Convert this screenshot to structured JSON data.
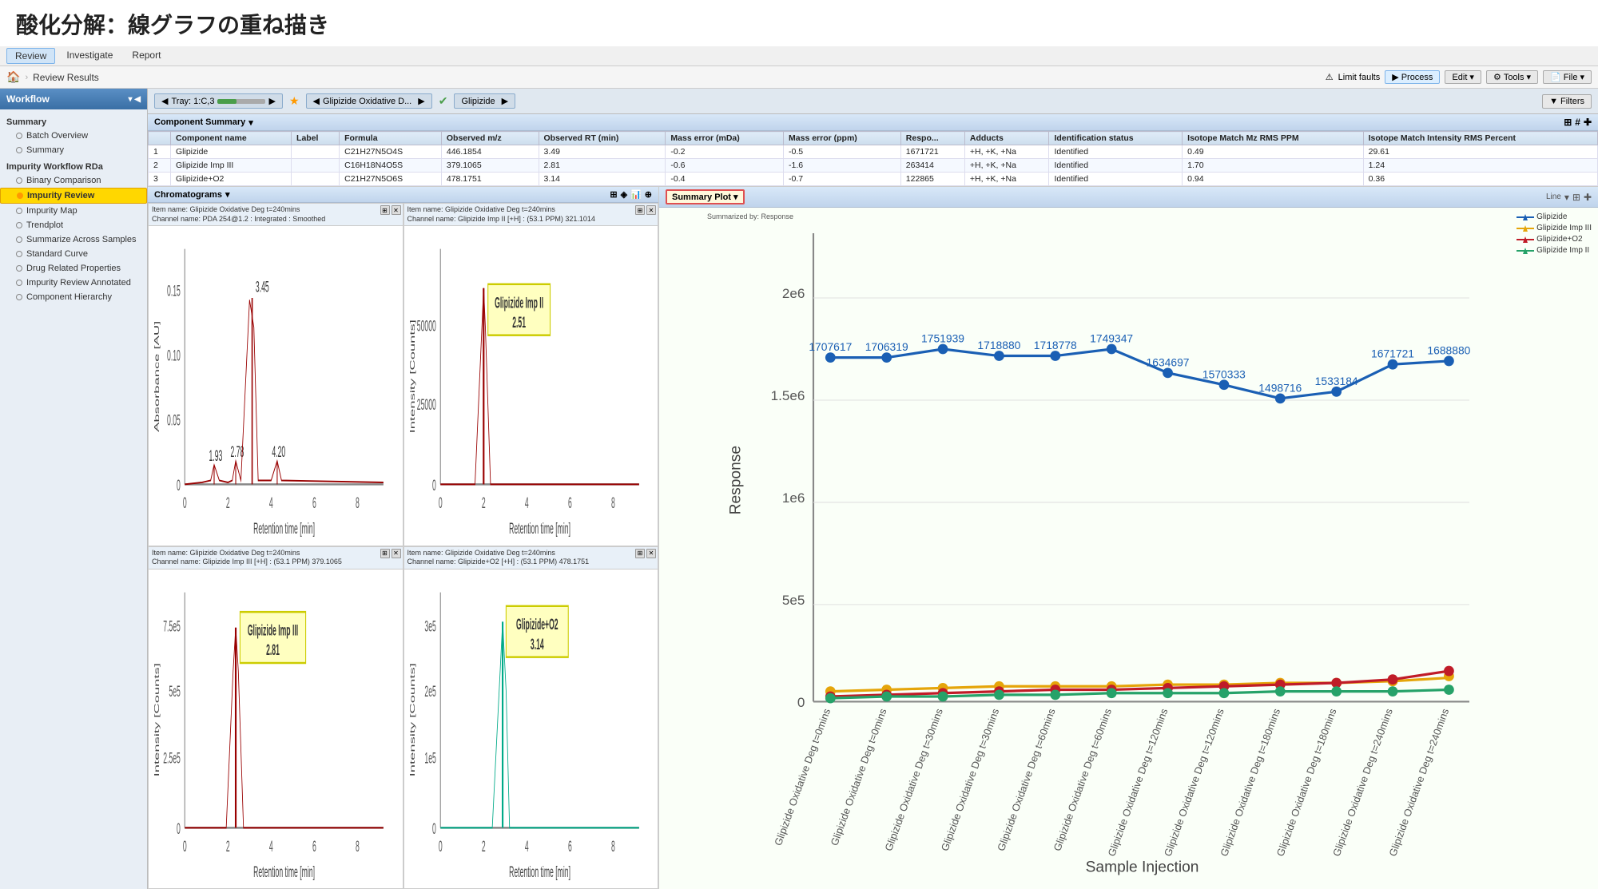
{
  "pageTitle": "酸化分解：線グラフの重ね描き",
  "menuItems": [
    {
      "label": "Review",
      "active": true
    },
    {
      "label": "Investigate",
      "active": false
    },
    {
      "label": "Report",
      "active": false
    }
  ],
  "toolbar": {
    "homeIcon": "🏠",
    "breadcrumb": "Review Results",
    "limitFaults": "Limit faults",
    "process": "Process",
    "edit": "Edit",
    "tools": "Tools",
    "file": "File",
    "filters": "Filters"
  },
  "tray": {
    "label": "Tray: 1:C,3",
    "sampleName": "Glipizide Oxidative D...",
    "compoundName": "Glipizide"
  },
  "sidebar": {
    "header": "Workflow",
    "sections": [
      {
        "label": "Summary",
        "items": [
          {
            "label": "Batch Overview",
            "active": false
          },
          {
            "label": "Summary",
            "active": false
          }
        ]
      },
      {
        "label": "Impurity Workflow RDa",
        "items": [
          {
            "label": "Binary Comparison",
            "active": false
          },
          {
            "label": "Impurity Review",
            "active": true
          },
          {
            "label": "Impurity Map",
            "active": false
          },
          {
            "label": "Trendplot",
            "active": false
          },
          {
            "label": "Summarize Across Samples",
            "active": false
          },
          {
            "label": "Standard Curve",
            "active": false
          },
          {
            "label": "Drug Related Properties",
            "active": false
          },
          {
            "label": "Impurity Review Annotated",
            "active": false
          },
          {
            "label": "Component Hierarchy",
            "active": false
          }
        ]
      }
    ]
  },
  "componentSummary": {
    "title": "Component Summary",
    "columns": [
      "",
      "Component name",
      "Label",
      "Formula",
      "Observed m/z",
      "Observed RT (min)",
      "Mass error (mDa)",
      "Mass error (ppm)",
      "Respo...",
      "Adducts",
      "Identification status",
      "Isotope Match Mz RMS PPM",
      "Isotope Match Intensity RMS Percent"
    ],
    "rows": [
      {
        "num": "1",
        "name": "Glipizide",
        "label": "",
        "formula": "C21H27N5O4S",
        "mz": "446.1854",
        "rt": "3.49",
        "massErrorMDa": "-0.2",
        "massErrorPpm": "-0.5",
        "response": "1671721",
        "adducts": "+H, +K, +Na",
        "status": "Identified",
        "isoMz": "0.49",
        "isoInt": "29.61"
      },
      {
        "num": "2",
        "name": "Glipizide Imp III",
        "label": "",
        "formula": "C16H18N4O5S",
        "mz": "379.1065",
        "rt": "2.81",
        "massErrorMDa": "-0.6",
        "massErrorPpm": "-1.6",
        "response": "263414",
        "adducts": "+H, +K, +Na",
        "status": "Identified",
        "isoMz": "1.70",
        "isoInt": "1.24"
      },
      {
        "num": "3",
        "name": "Glipizide+O2",
        "label": "",
        "formula": "C21H27N5O6S",
        "mz": "478.1751",
        "rt": "3.14",
        "massErrorMDa": "-0.4",
        "massErrorPpm": "-0.7",
        "response": "122865",
        "adducts": "+H, +K, +Na",
        "status": "Identified",
        "isoMz": "0.94",
        "isoInt": "0.36"
      }
    ]
  },
  "chromatograms": {
    "title": "Chromatograms",
    "cells": [
      {
        "id": "top-left",
        "itemName": "Item name: Glipizide Oxidative Deg t=240mins",
        "channelName": "Channel name: PDA 254@1.2 : Integrated : Smoothed",
        "yLabel": "Absorbance [AU]",
        "xLabel": "Retention time [min]",
        "yMax": "0.15",
        "peaks": [
          {
            "x": 3.45,
            "label": "3.45"
          },
          {
            "x": 1.93,
            "label": "1.93"
          },
          {
            "x": 2.78,
            "label": "2.78"
          },
          {
            "x": 4.2,
            "label": "4.20"
          }
        ],
        "color": "#c00"
      },
      {
        "id": "top-right",
        "itemName": "Item name: Glipizide Oxidative Deg t=240mins",
        "channelName": "Channel name: Glipizide Imp II [+H] : (53.1 PPM) 321.1014",
        "yLabel": "Intensity [Counts]",
        "xLabel": "Retention time [min]",
        "yMax": "50000",
        "peaks": [
          {
            "x": 2.51,
            "label": "2.51",
            "annotation": "Glipizide Imp II\n2.51"
          }
        ],
        "color": "#c00"
      },
      {
        "id": "bottom-left",
        "itemName": "Item name: Glipizide Oxidative Deg t=240mins",
        "channelName": "Channel name: Glipizide Imp III [+H] : (53.1 PPM) 379.1065",
        "yLabel": "Intensity [Counts]",
        "xLabel": "Retention time [min]",
        "yMax": "7.5e5",
        "peaks": [
          {
            "x": 2.81,
            "label": "2.81",
            "annotation": "Glipizide Imp III\n2.81"
          }
        ],
        "color": "#c00"
      },
      {
        "id": "bottom-right",
        "itemName": "Item name: Glipizide Oxidative Deg t=240mins",
        "channelName": "Channel name: Glipizide+O2 [+H] : (53.1 PPM) 478.1751",
        "yLabel": "Intensity [Counts]",
        "xLabel": "Retention time [min]",
        "yMax": "3e5",
        "peaks": [
          {
            "x": 3.14,
            "label": "3.14",
            "annotation": "Glipizide+O2\n3.14"
          }
        ],
        "color": "#0a0"
      }
    ]
  },
  "summaryPlot": {
    "title": "Summary Plot",
    "summarizedBy": "Summarized by: Response",
    "xLabel": "Sample Injection",
    "yLabel": "Response",
    "legend": [
      {
        "label": "Glipizide",
        "color": "#1a5fb4"
      },
      {
        "label": "Glipizide Imp III",
        "color": "#e5a50a"
      },
      {
        "label": "Glipizide+O2",
        "color": "#c01c28"
      },
      {
        "label": "Glipizide Imp II",
        "color": "#26a269"
      }
    ],
    "dataPoints": {
      "Glipizide": [
        1707617,
        1706319,
        1751939,
        1718880,
        1718778,
        1749347,
        1634697,
        1570333,
        1498716,
        1533184,
        1671721,
        1688880
      ],
      "GlipizideImpIII": [
        50000,
        55000,
        60000,
        65000,
        70000,
        75000,
        80000,
        85000,
        90000,
        95000,
        100000,
        120000
      ],
      "GlipizidePlusO2": [
        30000,
        35000,
        40000,
        50000,
        55000,
        60000,
        65000,
        75000,
        80000,
        90000,
        100000,
        150000
      ],
      "GlipizideImpII": [
        20000,
        22000,
        25000,
        28000,
        30000,
        35000,
        38000,
        42000,
        45000,
        50000,
        55000,
        60000
      ]
    },
    "xLabels": [
      "Glipizide Oxidative Deg t=0mins",
      "Glipizide Oxidative Deg t=0mins",
      "Glipizide Oxidative Deg t=30mins",
      "Glipizide Oxidative Deg t=30mins",
      "Glipizide Oxidative Deg t=60mins",
      "Glipizide Oxidative Deg t=60mins",
      "Glipizide Oxidative Deg t=120mins",
      "Glipizide Oxidative Deg t=120mins",
      "Glipizide Oxidative Deg t=180mins",
      "Glipizide Oxidative Deg t=180mins",
      "Glipizide Oxidative Deg t=240mins",
      "Glipizide Oxidative Deg t=240mins"
    ]
  }
}
